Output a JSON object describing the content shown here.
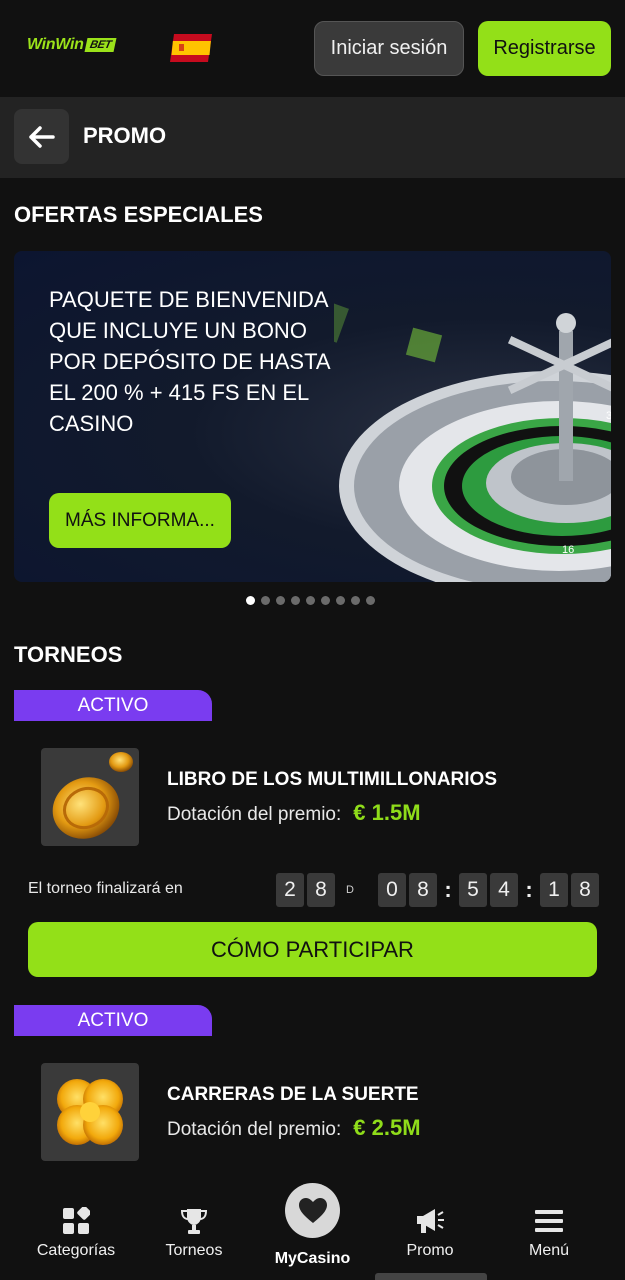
{
  "header": {
    "logo": {
      "part1": "Win",
      "part2": "Win",
      "part3": "BET"
    },
    "login_label": "Iniciar sesión",
    "register_label": "Registrarse"
  },
  "subheader": {
    "title": "PROMO"
  },
  "offers": {
    "title": "OFERTAS ESPECIALES",
    "banner": {
      "text": "PAQUETE DE BIENVENIDA QUE INCLUYE UN BONO POR DEPÓSITO DE HASTA EL 200 % + 415 FS EN EL CASINO",
      "button_label": "MÁS INFORMA..."
    },
    "carousel": {
      "count": 9,
      "active": 0
    }
  },
  "tournaments": {
    "title": "TORNEOS",
    "items": [
      {
        "status": "ACTIVO",
        "name": "LIBRO DE LOS MULTIMILLONARIOS",
        "prize_label": "Dotación del premio:",
        "prize_value": "€ 1.5M",
        "timer_label": "El torneo finalizará en",
        "timer": {
          "days": [
            "2",
            "8"
          ],
          "days_unit": "D",
          "hours": [
            "0",
            "8"
          ],
          "minutes": [
            "5",
            "4"
          ],
          "seconds": [
            "1",
            "8"
          ]
        },
        "button_label": "CÓMO PARTICIPAR"
      },
      {
        "status": "ACTIVO",
        "name": "CARRERAS DE LA SUERTE",
        "prize_label": "Dotación del premio:",
        "prize_value": "€ 2.5M"
      }
    ]
  },
  "bottom_nav": {
    "items": [
      {
        "label": "Categorías",
        "icon": "categories-icon"
      },
      {
        "label": "Torneos",
        "icon": "trophy-icon"
      },
      {
        "label": "MyCasino",
        "icon": "heart-icon"
      },
      {
        "label": "Promo",
        "icon": "megaphone-icon"
      },
      {
        "label": "Menú",
        "icon": "hamburger-icon"
      }
    ]
  },
  "colors": {
    "accent": "#93e018",
    "badge": "#7a3cf0",
    "background": "#111111"
  }
}
